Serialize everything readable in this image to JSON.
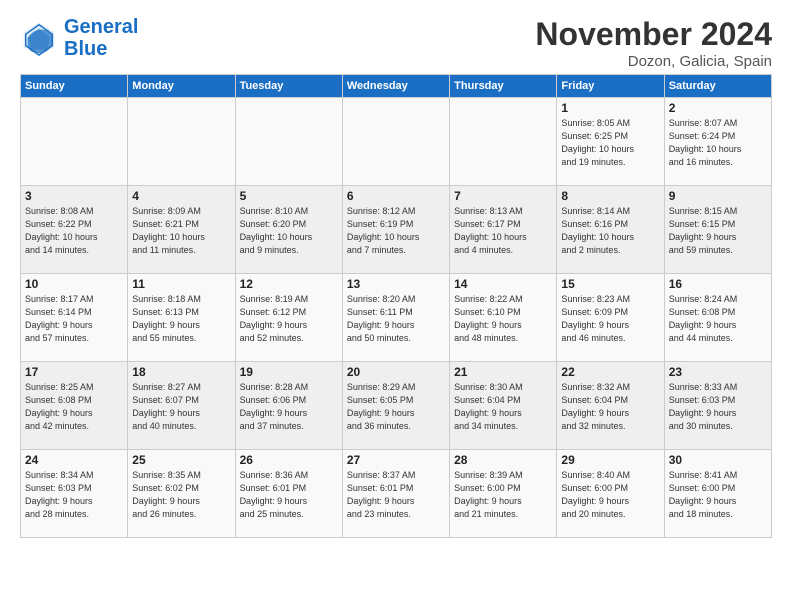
{
  "logo": {
    "line1": "General",
    "line2": "Blue"
  },
  "title": "November 2024",
  "subtitle": "Dozon, Galicia, Spain",
  "days_header": [
    "Sunday",
    "Monday",
    "Tuesday",
    "Wednesday",
    "Thursday",
    "Friday",
    "Saturday"
  ],
  "weeks": [
    [
      {
        "day": "",
        "info": ""
      },
      {
        "day": "",
        "info": ""
      },
      {
        "day": "",
        "info": ""
      },
      {
        "day": "",
        "info": ""
      },
      {
        "day": "",
        "info": ""
      },
      {
        "day": "1",
        "info": "Sunrise: 8:05 AM\nSunset: 6:25 PM\nDaylight: 10 hours\nand 19 minutes."
      },
      {
        "day": "2",
        "info": "Sunrise: 8:07 AM\nSunset: 6:24 PM\nDaylight: 10 hours\nand 16 minutes."
      }
    ],
    [
      {
        "day": "3",
        "info": "Sunrise: 8:08 AM\nSunset: 6:22 PM\nDaylight: 10 hours\nand 14 minutes."
      },
      {
        "day": "4",
        "info": "Sunrise: 8:09 AM\nSunset: 6:21 PM\nDaylight: 10 hours\nand 11 minutes."
      },
      {
        "day": "5",
        "info": "Sunrise: 8:10 AM\nSunset: 6:20 PM\nDaylight: 10 hours\nand 9 minutes."
      },
      {
        "day": "6",
        "info": "Sunrise: 8:12 AM\nSunset: 6:19 PM\nDaylight: 10 hours\nand 7 minutes."
      },
      {
        "day": "7",
        "info": "Sunrise: 8:13 AM\nSunset: 6:17 PM\nDaylight: 10 hours\nand 4 minutes."
      },
      {
        "day": "8",
        "info": "Sunrise: 8:14 AM\nSunset: 6:16 PM\nDaylight: 10 hours\nand 2 minutes."
      },
      {
        "day": "9",
        "info": "Sunrise: 8:15 AM\nSunset: 6:15 PM\nDaylight: 9 hours\nand 59 minutes."
      }
    ],
    [
      {
        "day": "10",
        "info": "Sunrise: 8:17 AM\nSunset: 6:14 PM\nDaylight: 9 hours\nand 57 minutes."
      },
      {
        "day": "11",
        "info": "Sunrise: 8:18 AM\nSunset: 6:13 PM\nDaylight: 9 hours\nand 55 minutes."
      },
      {
        "day": "12",
        "info": "Sunrise: 8:19 AM\nSunset: 6:12 PM\nDaylight: 9 hours\nand 52 minutes."
      },
      {
        "day": "13",
        "info": "Sunrise: 8:20 AM\nSunset: 6:11 PM\nDaylight: 9 hours\nand 50 minutes."
      },
      {
        "day": "14",
        "info": "Sunrise: 8:22 AM\nSunset: 6:10 PM\nDaylight: 9 hours\nand 48 minutes."
      },
      {
        "day": "15",
        "info": "Sunrise: 8:23 AM\nSunset: 6:09 PM\nDaylight: 9 hours\nand 46 minutes."
      },
      {
        "day": "16",
        "info": "Sunrise: 8:24 AM\nSunset: 6:08 PM\nDaylight: 9 hours\nand 44 minutes."
      }
    ],
    [
      {
        "day": "17",
        "info": "Sunrise: 8:25 AM\nSunset: 6:08 PM\nDaylight: 9 hours\nand 42 minutes."
      },
      {
        "day": "18",
        "info": "Sunrise: 8:27 AM\nSunset: 6:07 PM\nDaylight: 9 hours\nand 40 minutes."
      },
      {
        "day": "19",
        "info": "Sunrise: 8:28 AM\nSunset: 6:06 PM\nDaylight: 9 hours\nand 37 minutes."
      },
      {
        "day": "20",
        "info": "Sunrise: 8:29 AM\nSunset: 6:05 PM\nDaylight: 9 hours\nand 36 minutes."
      },
      {
        "day": "21",
        "info": "Sunrise: 8:30 AM\nSunset: 6:04 PM\nDaylight: 9 hours\nand 34 minutes."
      },
      {
        "day": "22",
        "info": "Sunrise: 8:32 AM\nSunset: 6:04 PM\nDaylight: 9 hours\nand 32 minutes."
      },
      {
        "day": "23",
        "info": "Sunrise: 8:33 AM\nSunset: 6:03 PM\nDaylight: 9 hours\nand 30 minutes."
      }
    ],
    [
      {
        "day": "24",
        "info": "Sunrise: 8:34 AM\nSunset: 6:03 PM\nDaylight: 9 hours\nand 28 minutes."
      },
      {
        "day": "25",
        "info": "Sunrise: 8:35 AM\nSunset: 6:02 PM\nDaylight: 9 hours\nand 26 minutes."
      },
      {
        "day": "26",
        "info": "Sunrise: 8:36 AM\nSunset: 6:01 PM\nDaylight: 9 hours\nand 25 minutes."
      },
      {
        "day": "27",
        "info": "Sunrise: 8:37 AM\nSunset: 6:01 PM\nDaylight: 9 hours\nand 23 minutes."
      },
      {
        "day": "28",
        "info": "Sunrise: 8:39 AM\nSunset: 6:00 PM\nDaylight: 9 hours\nand 21 minutes."
      },
      {
        "day": "29",
        "info": "Sunrise: 8:40 AM\nSunset: 6:00 PM\nDaylight: 9 hours\nand 20 minutes."
      },
      {
        "day": "30",
        "info": "Sunrise: 8:41 AM\nSunset: 6:00 PM\nDaylight: 9 hours\nand 18 minutes."
      }
    ]
  ]
}
